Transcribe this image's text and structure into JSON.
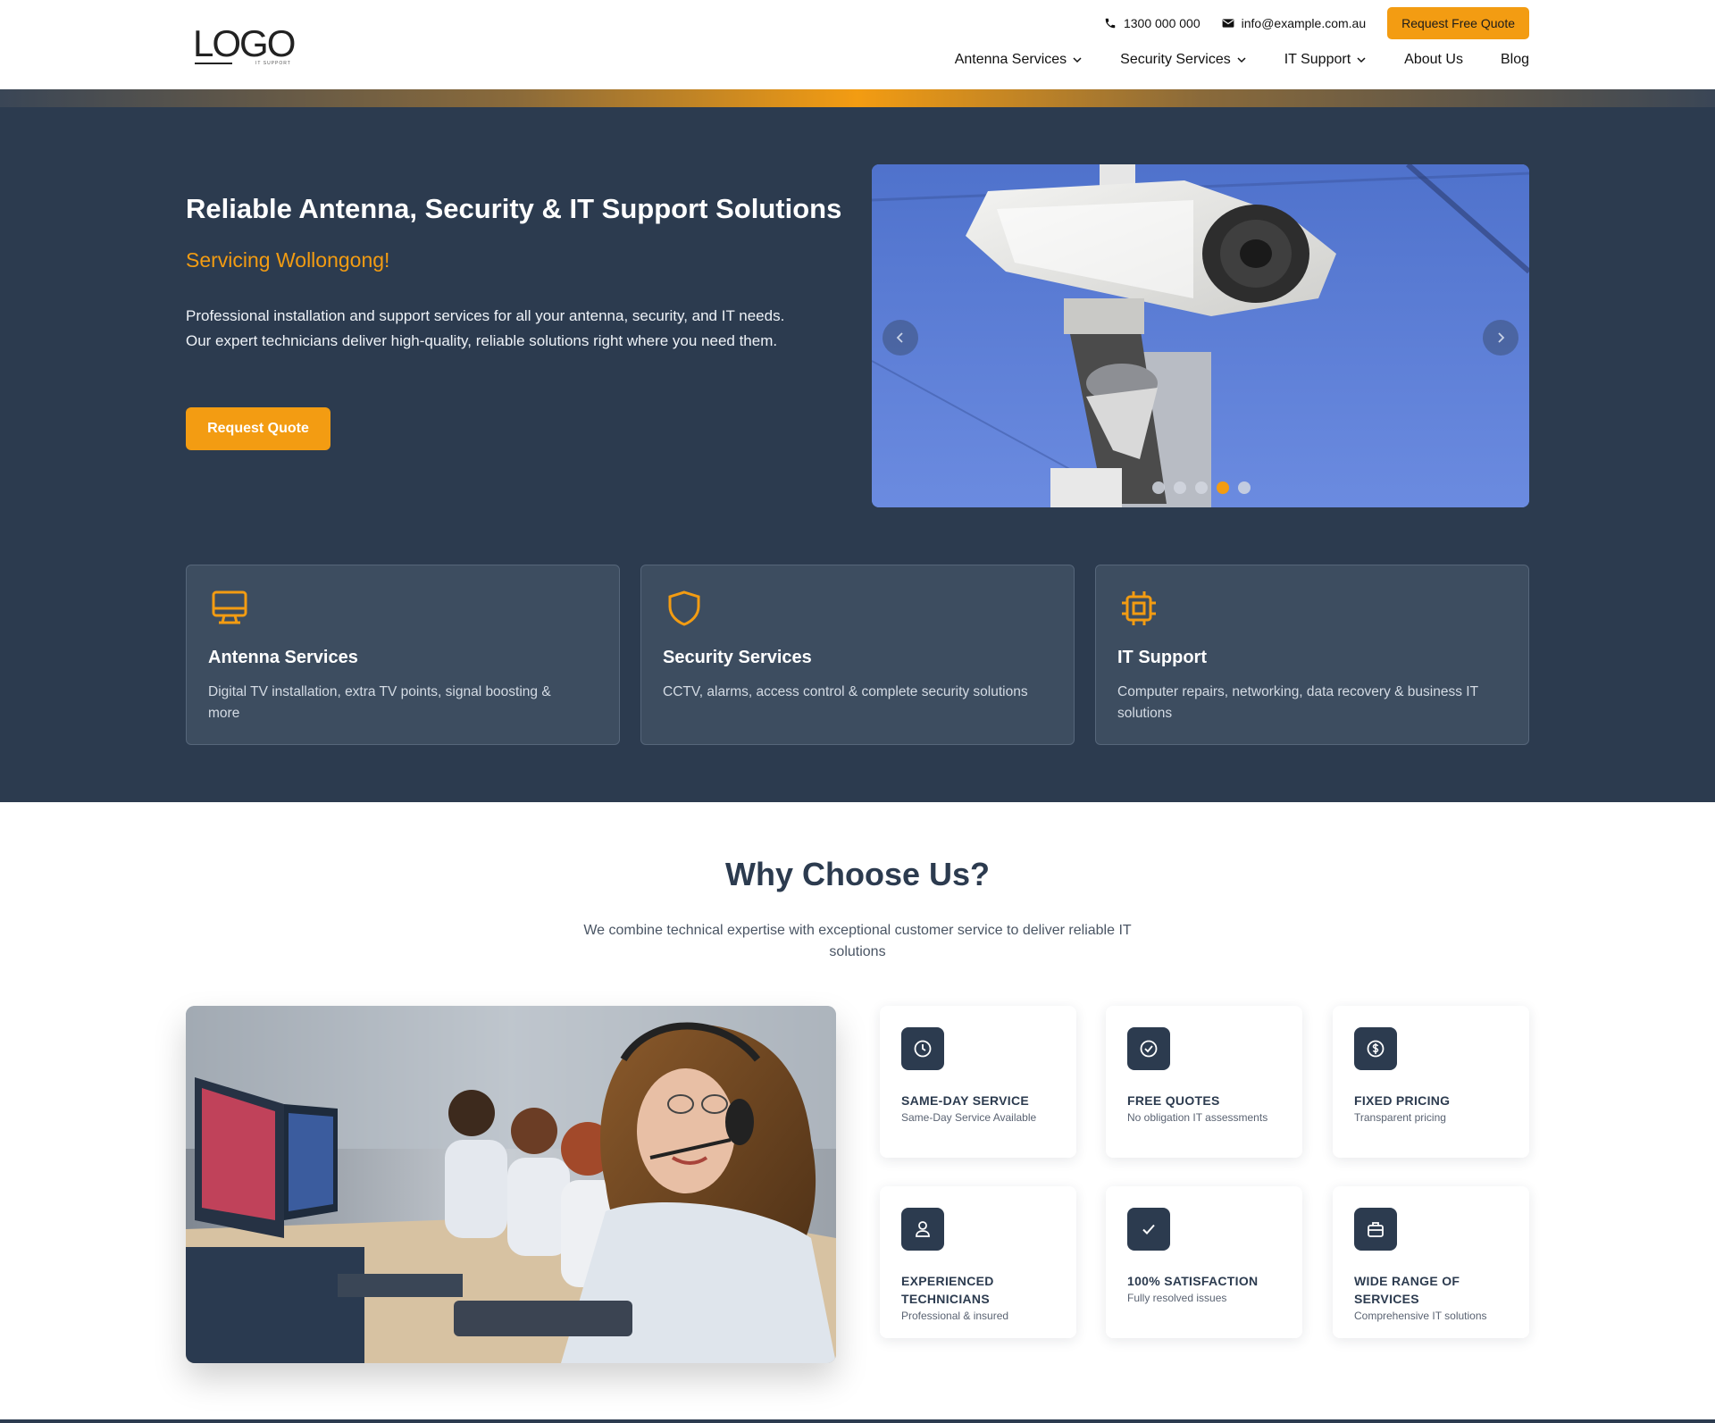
{
  "header": {
    "logo_text": "LOGO",
    "logo_subtext": "IT SUPPORT",
    "phone": "1300 000 000",
    "email": "info@example.com.au",
    "cta_label": "Request Free Quote",
    "nav": [
      {
        "label": "Antenna Services",
        "dropdown": true
      },
      {
        "label": "Security Services",
        "dropdown": true
      },
      {
        "label": "IT Support",
        "dropdown": true
      },
      {
        "label": "About Us",
        "dropdown": false
      },
      {
        "label": "Blog",
        "dropdown": false
      }
    ]
  },
  "hero": {
    "title": "Reliable Antenna, Security & IT Support Solutions",
    "subtitle": "Servicing Wollongong!",
    "description": "Professional installation and support services for all your antenna, security, and IT needs. Our expert technicians deliver high-quality, reliable solutions right where you need them.",
    "button_label": "Request Quote",
    "slider": {
      "slide_count": 5,
      "active_index": 3
    }
  },
  "services": [
    {
      "icon": "monitor-icon",
      "title": "Antenna Services",
      "description": "Digital TV installation, extra TV points, signal boosting & more"
    },
    {
      "icon": "shield-icon",
      "title": "Security Services",
      "description": "CCTV, alarms, access control & complete security solutions"
    },
    {
      "icon": "chip-icon",
      "title": "IT Support",
      "description": "Computer repairs, networking, data recovery & business IT solutions"
    }
  ],
  "why": {
    "title": "Why Choose Us?",
    "description": "We combine technical expertise with exceptional customer service to deliver reliable IT solutions",
    "features": [
      {
        "icon": "clock-icon",
        "title": "SAME-DAY SERVICE",
        "description": "Same-Day Service Available"
      },
      {
        "icon": "check-circle-icon",
        "title": "FREE QUOTES",
        "description": "No obligation IT assessments"
      },
      {
        "icon": "dollar-icon",
        "title": "FIXED PRICING",
        "description": "Transparent pricing"
      },
      {
        "icon": "user-icon",
        "title": "EXPERIENCED TECHNICIANS",
        "description": "Professional & insured"
      },
      {
        "icon": "check-icon",
        "title": "100% SATISFACTION",
        "description": "Fully resolved issues"
      },
      {
        "icon": "briefcase-icon",
        "title": "WIDE RANGE OF SERVICES",
        "description": "Comprehensive IT solutions"
      }
    ]
  },
  "colors": {
    "accent": "#f39c12",
    "navy": "#2c3b4f",
    "card": "#3d4d60"
  }
}
